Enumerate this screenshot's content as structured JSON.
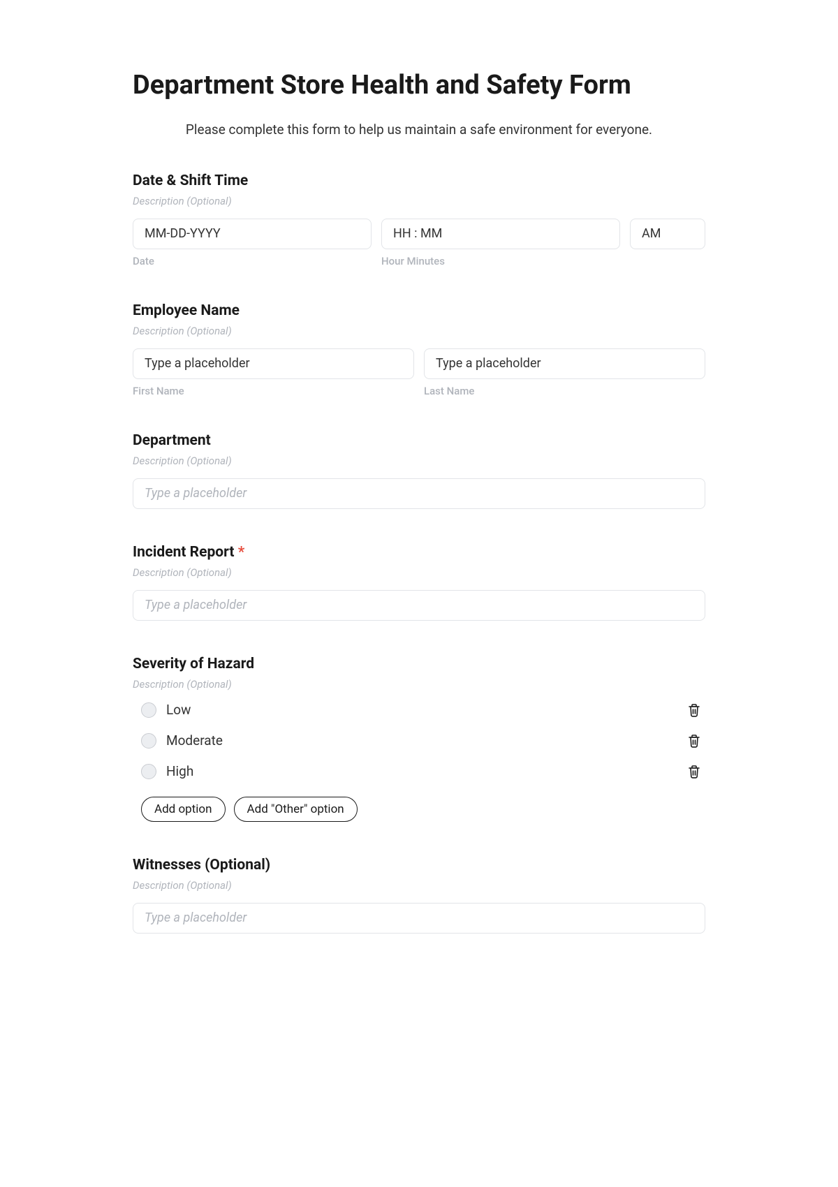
{
  "title": "Department Store Health and Safety Form",
  "subtitle": "Please complete this form to help us maintain a safe environment for everyone.",
  "desc_placeholder": "Description (Optional)",
  "dateShift": {
    "label": "Date & Shift Time",
    "date_ph": "MM-DD-YYYY",
    "date_sub": "Date",
    "time_ph": "HH : MM",
    "time_sub": "Hour Minutes",
    "ampm": "AM"
  },
  "employee": {
    "label": "Employee Name",
    "first_ph": "Type a placeholder",
    "first_sub": "First Name",
    "last_ph": "Type a placeholder",
    "last_sub": "Last Name"
  },
  "department": {
    "label": "Department",
    "ph": "Type a placeholder"
  },
  "incident": {
    "label": "Incident Report",
    "ph": "Type a placeholder"
  },
  "severity": {
    "label": "Severity of Hazard",
    "options": {
      "0": "Low",
      "1": "Moderate",
      "2": "High"
    },
    "add_label": "Add option",
    "add_other_label": "Add \"Other\" option"
  },
  "witnesses": {
    "label": "Witnesses (Optional)",
    "ph": "Type a placeholder"
  }
}
